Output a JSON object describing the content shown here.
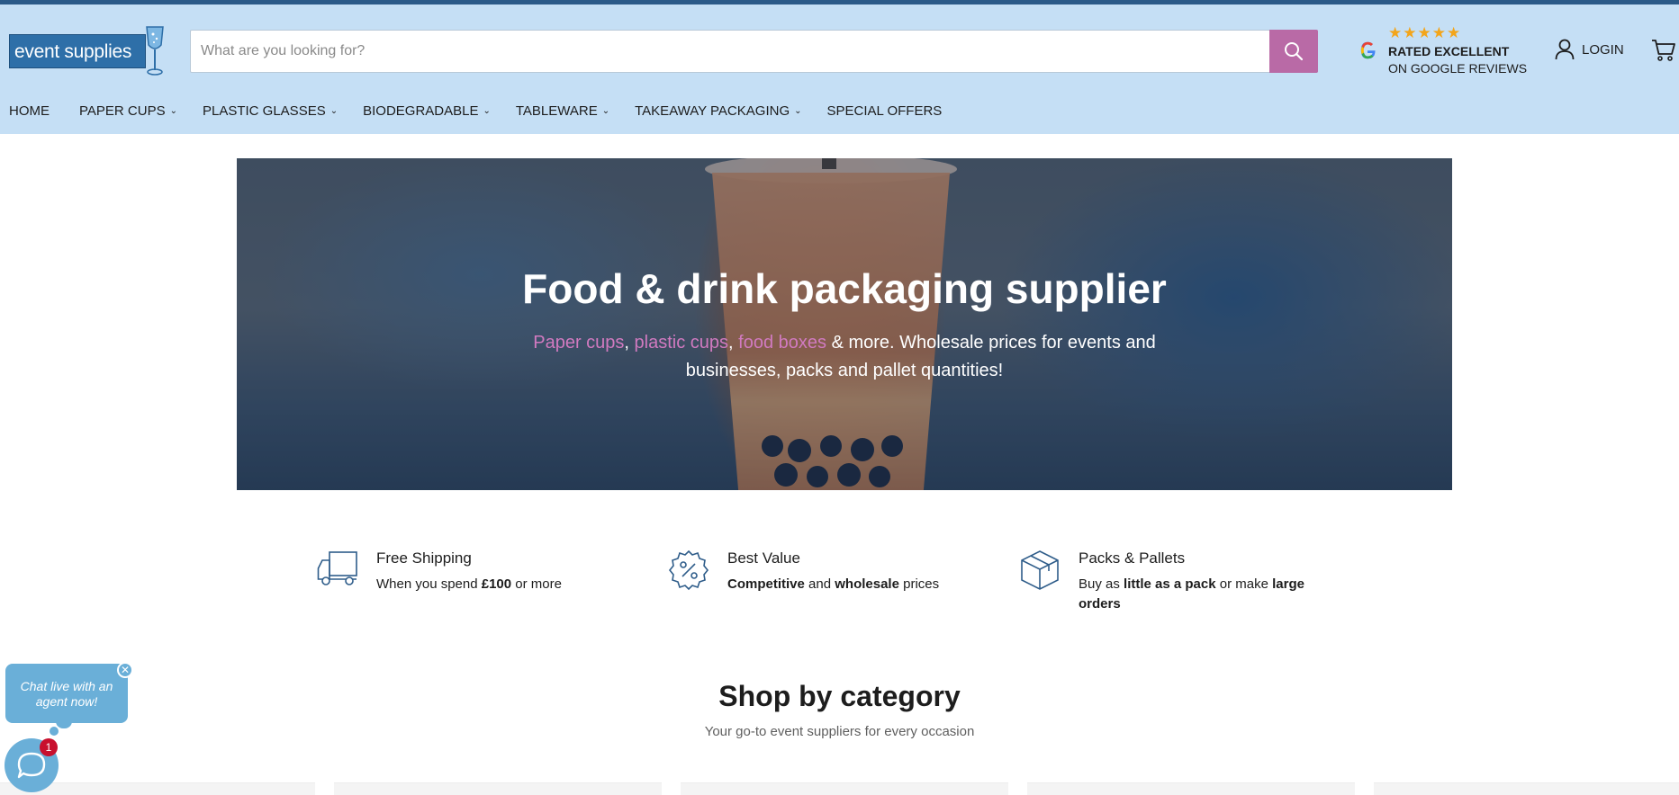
{
  "header": {
    "logo_text": "event supplies",
    "search_placeholder": "What are you looking for?",
    "reviews": {
      "stars": "★★★★★",
      "line1": "RATED EXCELLENT",
      "line2": "ON GOOGLE REVIEWS"
    },
    "login_label": "LOGIN"
  },
  "nav": {
    "items": [
      {
        "label": "HOME",
        "caret": ""
      },
      {
        "label": "PAPER CUPS",
        "caret": "⌄"
      },
      {
        "label": "PLASTIC GLASSES",
        "caret": "⌄"
      },
      {
        "label": "BIODEGRADABLE",
        "caret": "⌄"
      },
      {
        "label": "TABLEWARE",
        "caret": "⌄"
      },
      {
        "label": "TAKEAWAY PACKAGING",
        "caret": "⌄"
      },
      {
        "label": "SPECIAL OFFERS",
        "caret": ""
      }
    ]
  },
  "hero": {
    "title": "Food & drink packaging supplier",
    "links": [
      "Paper cups",
      "plastic cups",
      "food boxes"
    ],
    "sep1": ", ",
    "sep2": ", ",
    "text_rest": " & more. Wholesale prices for events and businesses, packs and pallet quantities!"
  },
  "features": [
    {
      "title": "Free Shipping",
      "d1": "When you spend ",
      "b1": "£100",
      "d2": " or more",
      "b2": "",
      "d3": "",
      "icon": "truck-icon"
    },
    {
      "title": "Best Value",
      "d1": "",
      "b1": "Competitive",
      "d2": " and ",
      "b2": "wholesale",
      "d3": " prices",
      "icon": "percent-badge-icon"
    },
    {
      "title": "Packs & Pallets",
      "d1": "Buy as ",
      "b1": "little as a pack",
      "d2": " or make ",
      "b2": "large orders",
      "d3": "",
      "icon": "box-icon"
    }
  ],
  "shop": {
    "title": "Shop by category",
    "subtitle": "Your go-to event suppliers for every occasion"
  },
  "chat": {
    "bubble_text": "Chat live with an agent now!",
    "badge_count": "1",
    "close_glyph": "✕"
  },
  "colors": {
    "topbar": "#2b5a88",
    "header_bg": "#c5dff5",
    "search_button": "#b96aa6",
    "link_pink": "#d17ac0",
    "chat_blue": "#6aafd8",
    "badge_red": "#c8102e",
    "icon_blue": "#2f5d8a"
  }
}
